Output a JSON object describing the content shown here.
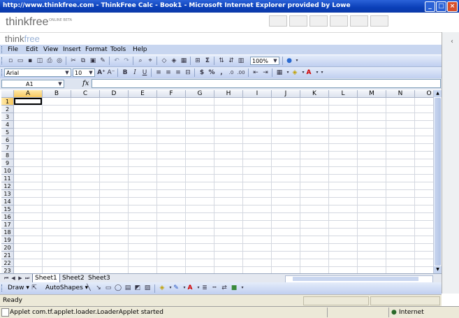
{
  "window": {
    "title": "http://www.thinkfree.com - ThinkFree Calc - Book1 - Microsoft Internet Explorer provided by Lowe"
  },
  "header": {
    "logo": "thinkfree",
    "beta": "ONLINE BETA"
  },
  "app": {
    "logo_think": "think",
    "logo_free": "free"
  },
  "menu": [
    "File",
    "Edit",
    "View",
    "Insert",
    "Format",
    "Tools",
    "Help"
  ],
  "toolbar": {
    "zoom": "100%"
  },
  "format": {
    "font": "Arial",
    "size": "10"
  },
  "formula": {
    "cell_ref": "A1",
    "fx": "fx",
    "value": ""
  },
  "grid": {
    "columns": [
      "A",
      "B",
      "C",
      "D",
      "E",
      "F",
      "G",
      "H",
      "I",
      "J",
      "K",
      "L",
      "M",
      "N",
      "O"
    ],
    "rows": [
      "1",
      "2",
      "3",
      "4",
      "5",
      "6",
      "7",
      "8",
      "9",
      "10",
      "11",
      "12",
      "13",
      "14",
      "15",
      "16",
      "17",
      "18",
      "19",
      "20",
      "21",
      "22",
      "23"
    ],
    "active_cell": "A1"
  },
  "sheets": [
    "Sheet1",
    "Sheet2",
    "Sheet3"
  ],
  "drawbar": {
    "draw": "Draw",
    "autoshapes": "AutoShapes"
  },
  "status": {
    "app": "Ready",
    "browser": "Applet com.tf.applet.loader.LoaderApplet started",
    "zone": "Internet"
  },
  "colors": {
    "title_bar": "#0a3fb8",
    "toolbar": "#c8d6f0",
    "selected_header": "#f7c860"
  }
}
